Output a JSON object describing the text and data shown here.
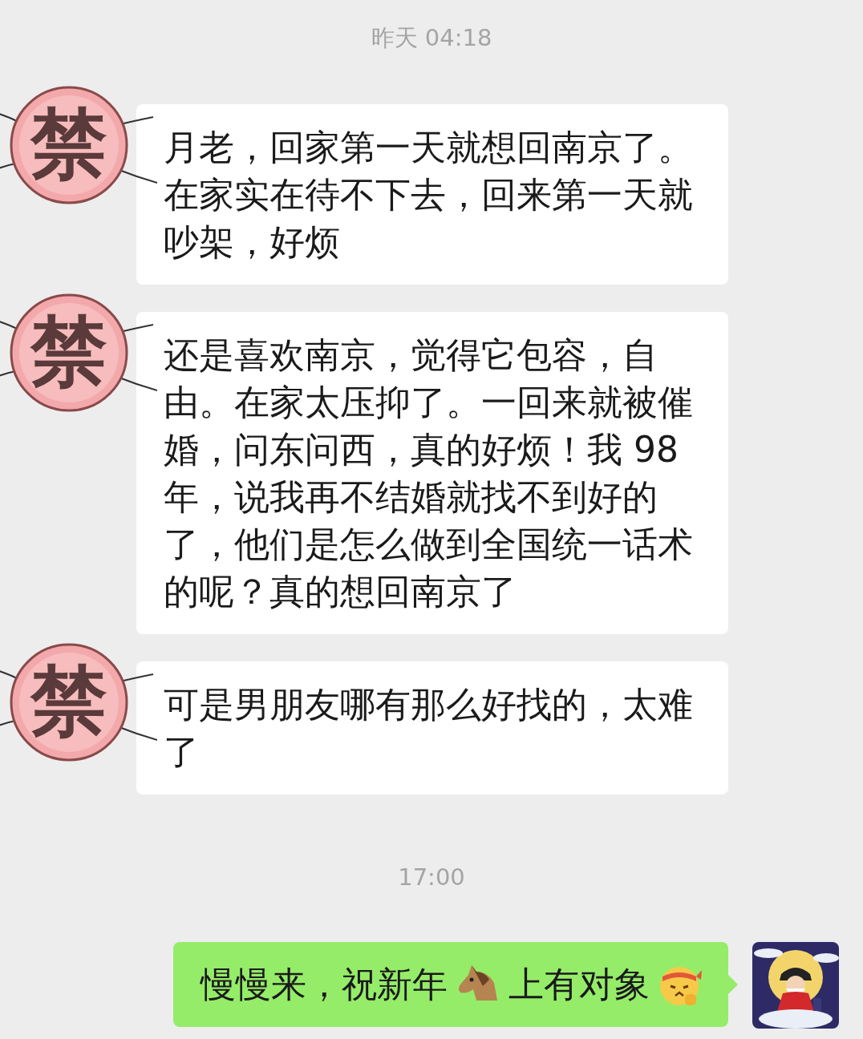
{
  "timestamps": [
    "昨天 04:18",
    "17:00"
  ],
  "incoming": [
    {
      "avatar_text": "禁",
      "text": "月老，回家第一天就想回南京了。在家实在待不下去，回来第一天就吵架，好烦"
    },
    {
      "avatar_text": "禁",
      "text": "还是喜欢南京，觉得它包容，自由。在家太压抑了。一回来就被催婚，问东问西，真的好烦！我 98 年，说我再不结婚就找不到好的了，他们是怎么做到全国统一话术的呢？真的想回南京了"
    },
    {
      "avatar_text": "禁",
      "text": "可是男朋友哪有那么好找的，太难了"
    }
  ],
  "outgoing": {
    "parts": [
      {
        "kind": "text",
        "text": "慢慢来，祝新年"
      },
      {
        "kind": "horse"
      },
      {
        "kind": "text",
        "text": "上有对象"
      },
      {
        "kind": "face"
      }
    ]
  }
}
